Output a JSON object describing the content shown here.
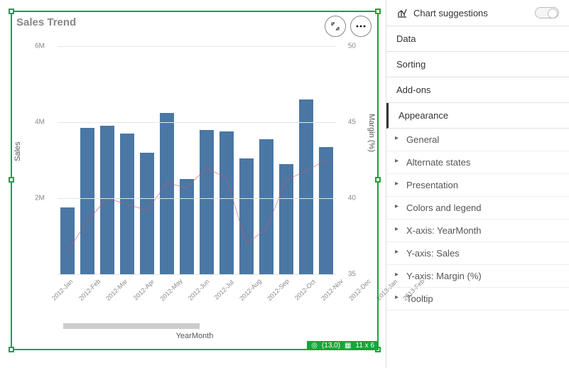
{
  "chart_data": {
    "type": "combo",
    "title": "Sales Trend",
    "xlabel": "YearMonth",
    "categories": [
      "2012-Jan",
      "2012-Feb",
      "2012-Mar",
      "2012-Apr",
      "2012-May",
      "2012-Jun",
      "2012-Jul",
      "2012-Aug",
      "2012-Sep",
      "2012-Oct",
      "2012-Nov",
      "2012-Dec",
      "2013-Jan",
      "2013-Feb"
    ],
    "series": [
      {
        "name": "Sales",
        "type": "bar",
        "axis": "left",
        "values": [
          1750000,
          3850000,
          3900000,
          3700000,
          3200000,
          4250000,
          2500000,
          3800000,
          3750000,
          3050000,
          3550000,
          2900000,
          4600000,
          3350000
        ],
        "ylabel": "Sales",
        "ylim": [
          0,
          6000000
        ],
        "ticks": [
          {
            "v": 0,
            "l": ""
          },
          {
            "v": 2000000,
            "l": "2M"
          },
          {
            "v": 4000000,
            "l": "4M"
          },
          {
            "v": 6000000,
            "l": "6M"
          }
        ]
      },
      {
        "name": "Margin (%)",
        "type": "line",
        "axis": "right",
        "values": [
          36.5,
          38.5,
          40.0,
          39.6,
          39.2,
          41.0,
          40.7,
          42.0,
          41.3,
          37.0,
          38.0,
          41.2,
          41.8,
          42.5
        ],
        "ylabel": "Margin (%)",
        "ylim": [
          35,
          50
        ],
        "ticks": [
          {
            "v": 35,
            "l": "35"
          },
          {
            "v": 40,
            "l": "40"
          },
          {
            "v": 45,
            "l": "45"
          },
          {
            "v": 50,
            "l": "50"
          }
        ]
      }
    ]
  },
  "selection_info": {
    "coord": "(13,0)",
    "size": "11 x 6"
  },
  "right_panel": {
    "suggestions_label": "Chart suggestions",
    "sections": [
      "Data",
      "Sorting",
      "Add-ons",
      "Appearance"
    ],
    "active_section": "Appearance",
    "appearance_items": [
      "General",
      "Alternate states",
      "Presentation",
      "Colors and legend",
      "X-axis: YearMonth",
      "Y-axis: Sales",
      "Y-axis: Margin (%)",
      "Tooltip"
    ]
  }
}
